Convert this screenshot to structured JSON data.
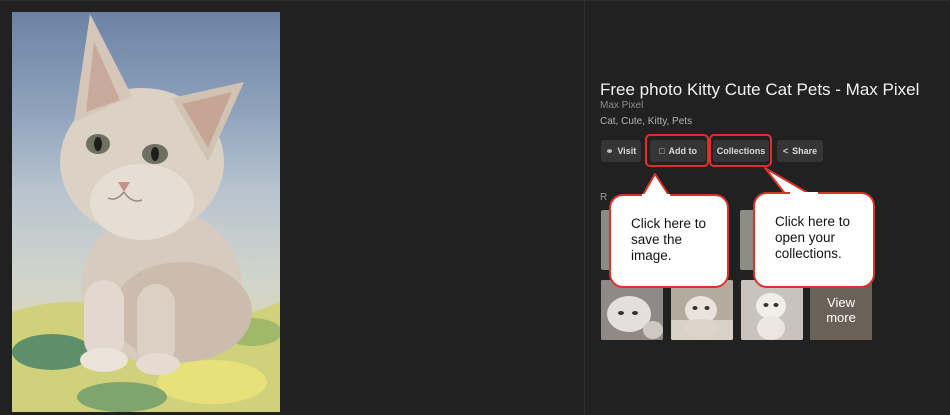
{
  "title": "Free photo Kitty Cute Cat Pets - Max Pixel",
  "source": "Max Pixel",
  "tags": "Cat, Cute, Kitty, Pets",
  "actions": {
    "visit": "Visit",
    "add_to": "Add to",
    "collections": "Collections",
    "share": "Share"
  },
  "related_heading": "R",
  "view_more": "View more",
  "callouts": {
    "add_to": "Click here to save the image.",
    "collections": "Click here to open your collections."
  },
  "colors": {
    "background": "#212121",
    "button": "#353535",
    "highlight": "#d8332b",
    "callout_bg": "#ffffff"
  },
  "icons": {
    "visit": "globe-icon",
    "add_to": "bookmark-icon",
    "share": "share-icon"
  }
}
